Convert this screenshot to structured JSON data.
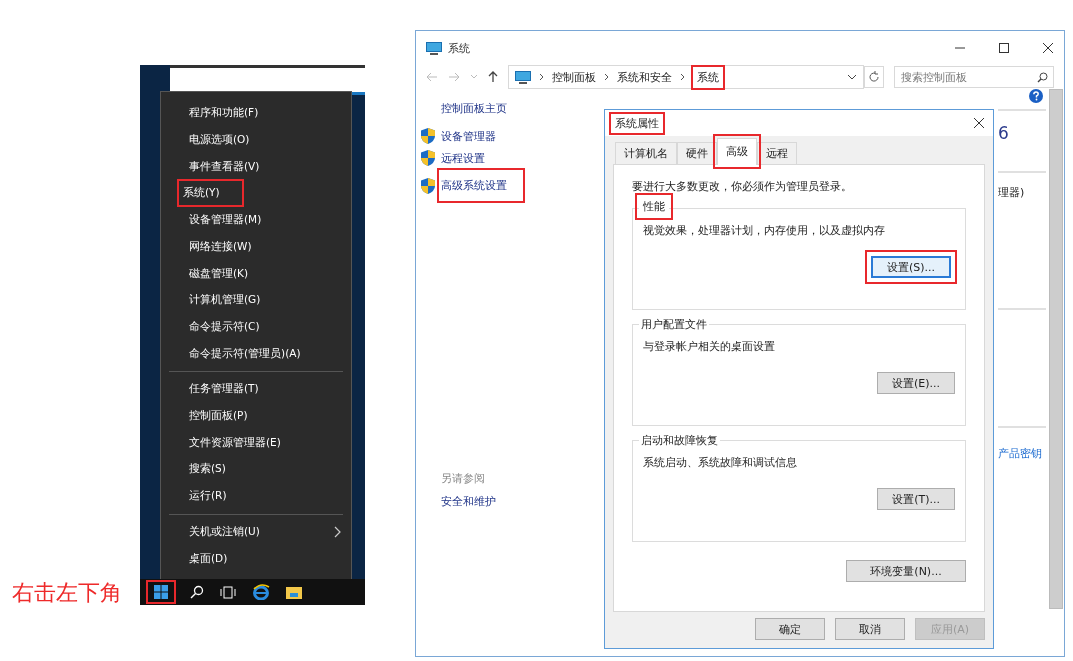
{
  "caption": "右击左下角",
  "start_menu": {
    "sections": [
      [
        {
          "label": "程序和功能(F)",
          "highlighted": false,
          "has_submenu": false
        },
        {
          "label": "电源选项(O)",
          "highlighted": false,
          "has_submenu": false
        },
        {
          "label": "事件查看器(V)",
          "highlighted": false,
          "has_submenu": false
        },
        {
          "label": "系统(Y)",
          "highlighted": true,
          "has_submenu": false
        },
        {
          "label": "设备管理器(M)",
          "highlighted": false,
          "has_submenu": false
        },
        {
          "label": "网络连接(W)",
          "highlighted": false,
          "has_submenu": false
        },
        {
          "label": "磁盘管理(K)",
          "highlighted": false,
          "has_submenu": false
        },
        {
          "label": "计算机管理(G)",
          "highlighted": false,
          "has_submenu": false
        },
        {
          "label": "命令提示符(C)",
          "highlighted": false,
          "has_submenu": false
        },
        {
          "label": "命令提示符(管理员)(A)",
          "highlighted": false,
          "has_submenu": false
        }
      ],
      [
        {
          "label": "任务管理器(T)",
          "highlighted": false,
          "has_submenu": false
        },
        {
          "label": "控制面板(P)",
          "highlighted": false,
          "has_submenu": false
        },
        {
          "label": "文件资源管理器(E)",
          "highlighted": false,
          "has_submenu": false
        },
        {
          "label": "搜索(S)",
          "highlighted": false,
          "has_submenu": false
        },
        {
          "label": "运行(R)",
          "highlighted": false,
          "has_submenu": false
        }
      ],
      [
        {
          "label": "关机或注销(U)",
          "highlighted": false,
          "has_submenu": true
        },
        {
          "label": "桌面(D)",
          "highlighted": false,
          "has_submenu": false
        }
      ]
    ]
  },
  "taskbar": {
    "start_highlighted": true
  },
  "system_window": {
    "title": "系统",
    "breadcrumb": [
      {
        "label": "控制面板",
        "highlighted": false
      },
      {
        "label": "系统和安全",
        "highlighted": false
      },
      {
        "label": "系统",
        "highlighted": true
      }
    ],
    "search": {
      "placeholder": "搜索控制面板"
    },
    "sidebar": {
      "home": "控制面板主页",
      "links": [
        {
          "label": "设备管理器",
          "highlighted": false
        },
        {
          "label": "远程设置",
          "highlighted": false
        },
        {
          "label": "高级系统设置",
          "highlighted": true
        }
      ],
      "see_also_title": "另请参阅",
      "see_also": [
        "安全和维护"
      ]
    },
    "fragments": [
      "6",
      "理器)",
      "产品密钥"
    ]
  },
  "dialog": {
    "title": "系统属性",
    "title_highlighted": true,
    "tabs": [
      {
        "label": "计算机名",
        "selected": false,
        "highlighted": false
      },
      {
        "label": "硬件",
        "selected": false,
        "highlighted": false
      },
      {
        "label": "高级",
        "selected": true,
        "highlighted": true
      },
      {
        "label": "远程",
        "selected": false,
        "highlighted": false
      }
    ],
    "notice": "要进行大多数更改，你必须作为管理员登录。",
    "groups": [
      {
        "title": "性能",
        "highlighted": true,
        "description": "视觉效果，处理器计划，内存使用，以及虚拟内存",
        "button": {
          "label": "设置(S)...",
          "highlighted": true,
          "focused": true
        }
      },
      {
        "title": "用户配置文件",
        "highlighted": false,
        "description": "与登录帐户相关的桌面设置",
        "button": {
          "label": "设置(E)...",
          "highlighted": false,
          "focused": false
        }
      },
      {
        "title": "启动和故障恢复",
        "highlighted": false,
        "description": "系统启动、系统故障和调试信息",
        "button": {
          "label": "设置(T)...",
          "highlighted": false,
          "focused": false
        }
      }
    ],
    "env_button": "环境变量(N)...",
    "footer_buttons": [
      {
        "label": "确定",
        "disabled": false
      },
      {
        "label": "取消",
        "disabled": false
      },
      {
        "label": "应用(A)",
        "disabled": true
      }
    ]
  }
}
